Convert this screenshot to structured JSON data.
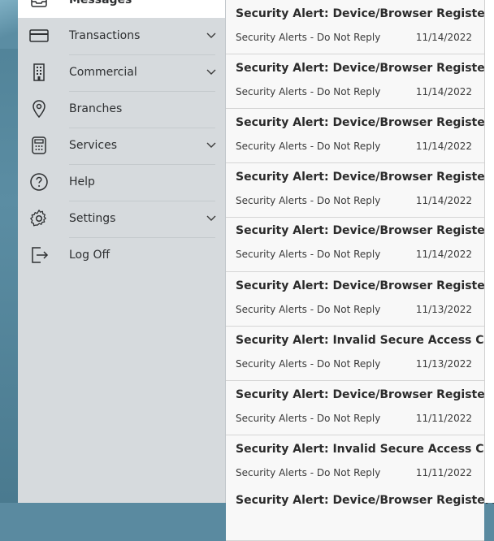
{
  "sidebar": {
    "items": [
      {
        "label": "Messages",
        "icon": "messages-icon",
        "has_chevron": false
      },
      {
        "label": "Transactions",
        "icon": "credit-card-icon",
        "has_chevron": true
      },
      {
        "label": "Commercial",
        "icon": "building-icon",
        "has_chevron": true
      },
      {
        "label": "Branches",
        "icon": "map-pin-icon",
        "has_chevron": false
      },
      {
        "label": "Services",
        "icon": "calculator-icon",
        "has_chevron": true
      },
      {
        "label": "Help",
        "icon": "help-icon",
        "has_chevron": false
      },
      {
        "label": "Settings",
        "icon": "gear-icon",
        "has_chevron": true
      },
      {
        "label": "Log Off",
        "icon": "log-off-icon",
        "has_chevron": false
      }
    ]
  },
  "messages": [
    {
      "subject": "Security Alert: Device/Browser Registered",
      "sender": "Security Alerts - Do Not Reply",
      "date": "11/14/2022"
    },
    {
      "subject": "Security Alert: Device/Browser Registered",
      "sender": "Security Alerts - Do Not Reply",
      "date": "11/14/2022"
    },
    {
      "subject": "Security Alert: Device/Browser Registered",
      "sender": "Security Alerts - Do Not Reply",
      "date": "11/14/2022"
    },
    {
      "subject": "Security Alert: Device/Browser Registered",
      "sender": "Security Alerts - Do Not Reply",
      "date": "11/14/2022"
    },
    {
      "subject": "Security Alert: Device/Browser Registered",
      "sender": "Security Alerts - Do Not Reply",
      "date": "11/14/2022"
    },
    {
      "subject": "Security Alert: Device/Browser Registered",
      "sender": "Security Alerts - Do Not Reply",
      "date": "11/13/2022"
    },
    {
      "subject": "Security Alert: Invalid Secure Access Code",
      "sender": "Security Alerts - Do Not Reply",
      "date": "11/13/2022"
    },
    {
      "subject": "Security Alert: Device/Browser Registered",
      "sender": "Security Alerts - Do Not Reply",
      "date": "11/11/2022"
    },
    {
      "subject": "Security Alert: Invalid Secure Access Code",
      "sender": "Security Alerts - Do Not Reply",
      "date": "11/11/2022"
    },
    {
      "subject": "Security Alert: Device/Browser Registered",
      "sender": "",
      "date": ""
    }
  ]
}
